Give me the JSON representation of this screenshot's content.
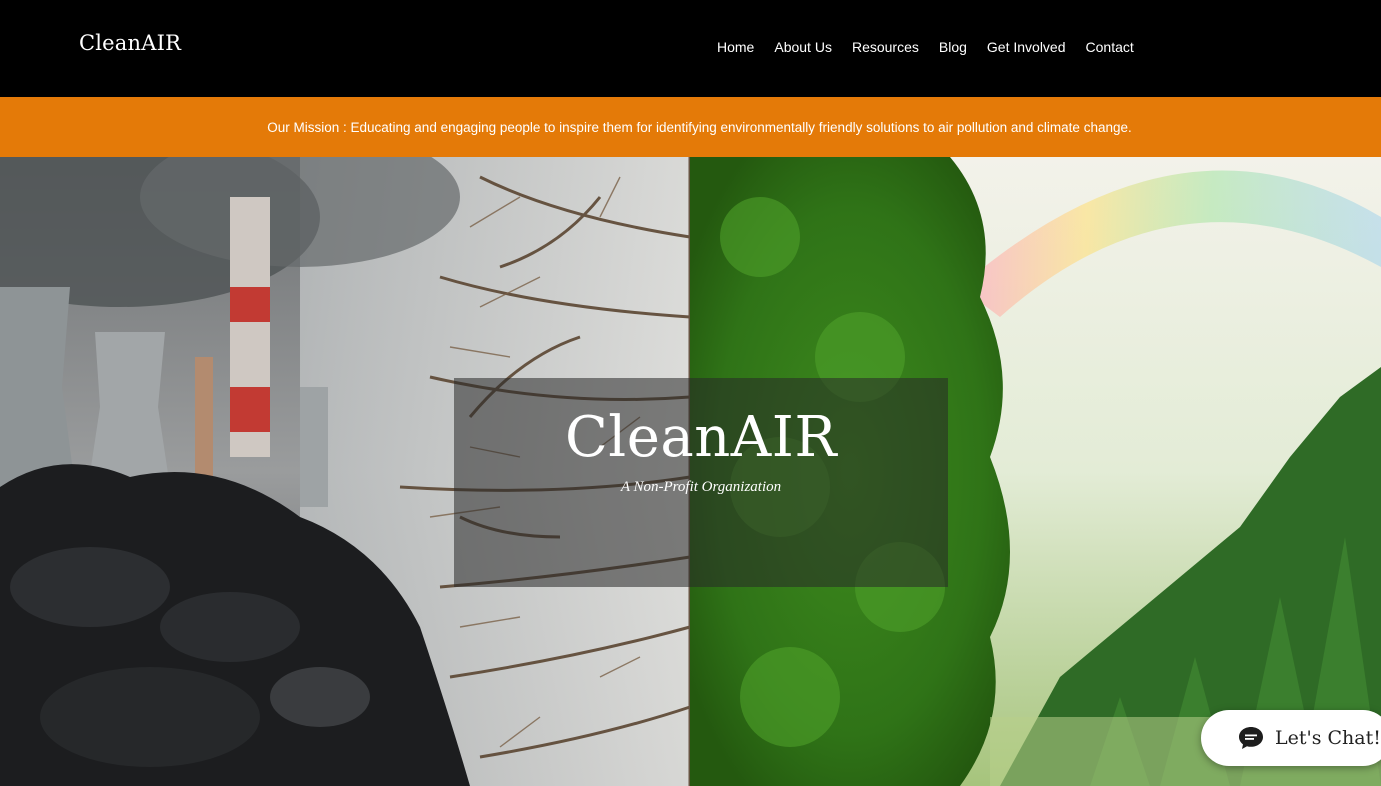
{
  "header": {
    "logo": "CleanAIR",
    "nav": [
      "Home",
      "About Us",
      "Resources",
      "Blog",
      "Get Involved",
      "Contact"
    ]
  },
  "mission": {
    "text": "Our Mission : Educating and engaging people to inspire them for identifying environmentally friendly solutions to air pollution and climate change."
  },
  "hero": {
    "title": "CleanAIR",
    "subtitle": "A Non-Profit Organization"
  },
  "chat": {
    "label": "Let's Chat!"
  },
  "colors": {
    "header_bg": "#000000",
    "banner_bg": "#e47a08",
    "text": "#ffffff"
  }
}
